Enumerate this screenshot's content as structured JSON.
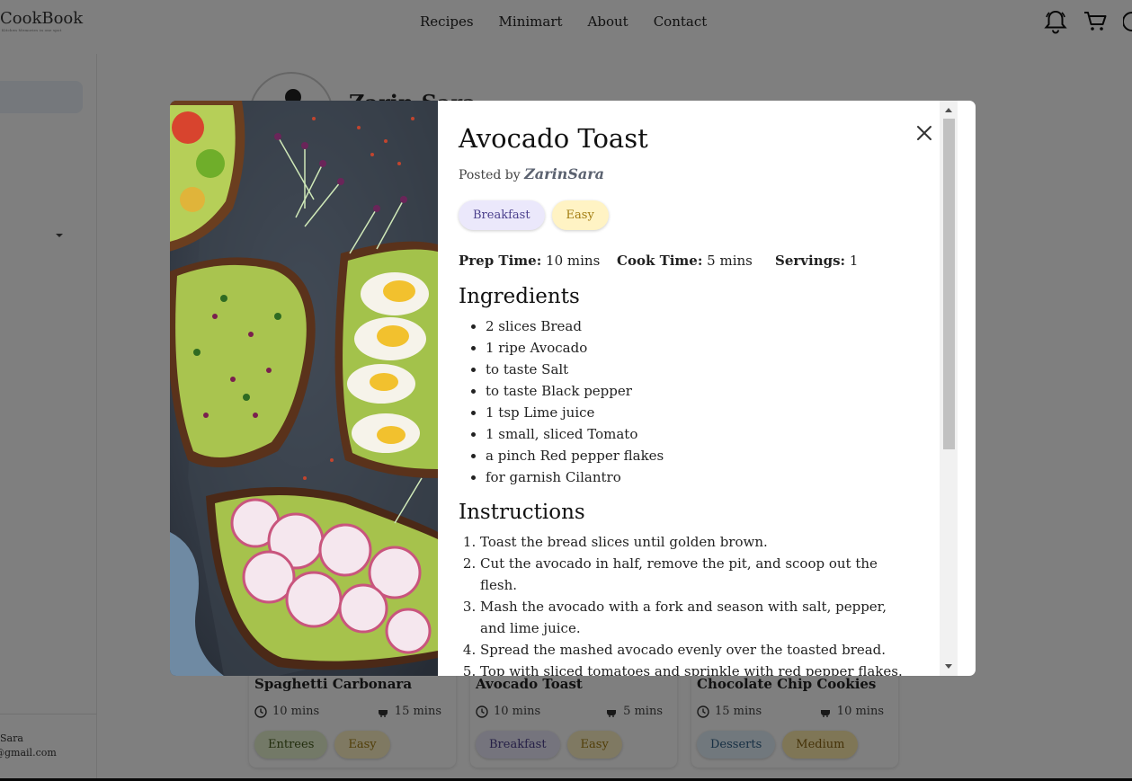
{
  "header": {
    "logo": "CookBook",
    "logo_tagline": "Kitchen Memories in one spot",
    "nav": [
      "Recipes",
      "Minimart",
      "About",
      "Contact"
    ]
  },
  "sidebar": {
    "user_name": "Sara",
    "user_email": "@gmail.com"
  },
  "profile": {
    "name": "Zarin Sara"
  },
  "cards": [
    {
      "title": "Spaghetti Carbonara",
      "prep": "10 mins",
      "cook": "15 mins",
      "tags": [
        "Entrees",
        "Easy"
      ]
    },
    {
      "title": "Avocado Toast",
      "prep": "10 mins",
      "cook": "5 mins",
      "tags": [
        "Breakfast",
        "Easy"
      ]
    },
    {
      "title": "Chocolate Chip Cookies",
      "prep": "15 mins",
      "cook": "10 mins",
      "tags": [
        "Desserts",
        "Medium"
      ]
    }
  ],
  "modal": {
    "title": "Avocado Toast",
    "posted_by_label": "Posted by",
    "author": "ZarinSara",
    "tags": [
      "Breakfast",
      "Easy"
    ],
    "prep_label": "Prep Time:",
    "prep_value": "10 mins",
    "cook_label": "Cook Time:",
    "cook_value": "5 mins",
    "servings_label": "Servings:",
    "servings_value": "1",
    "ingredients_title": "Ingredients",
    "ingredients": [
      "2 slices Bread",
      "1 ripe Avocado",
      "to taste Salt",
      "to taste Black pepper",
      "1 tsp Lime juice",
      "1 small, sliced Tomato",
      "a pinch Red pepper flakes",
      "for garnish Cilantro"
    ],
    "instructions_title": "Instructions",
    "instructions": [
      "Toast the bread slices until golden brown.",
      "Cut the avocado in half, remove the pit, and scoop out the flesh.",
      "Mash the avocado with a fork and season with salt, pepper, and lime juice.",
      "Spread the mashed avocado evenly over the toasted bread.",
      "Top with sliced tomatoes and sprinkle with red pepper flakes."
    ]
  },
  "colors": {
    "breakfast_bg": "#ebe8fb",
    "easy_bg": "#fff3c4",
    "entrees_bg": "#e7f3cf",
    "desserts_bg": "#e3f1fb",
    "medium_bg": "#ffecad",
    "overlay": "rgba(0,0,0,0.5)"
  }
}
